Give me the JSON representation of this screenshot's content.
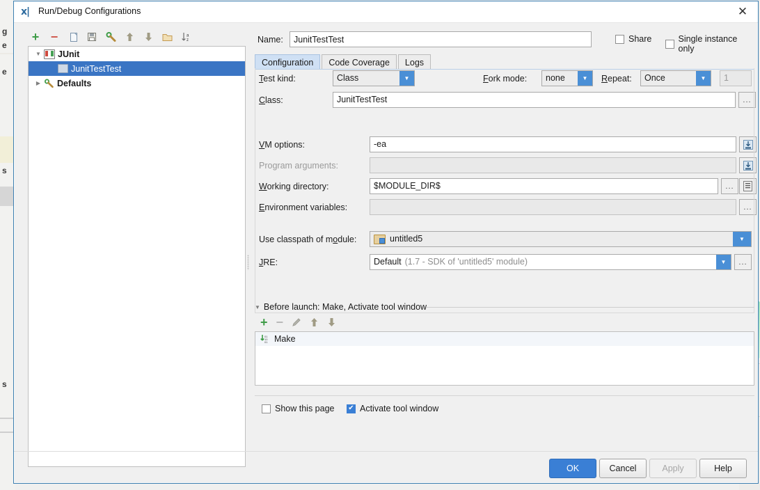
{
  "window": {
    "title": "Run/Debug Configurations",
    "icon": "intellij-junit-icon",
    "close_label": "✕"
  },
  "toolbar": {
    "buttons": [
      {
        "name": "add-configuration-button",
        "glyph": "+",
        "kind": "plus"
      },
      {
        "name": "remove-configuration-button",
        "glyph": "−",
        "kind": "minus"
      },
      {
        "name": "copy-configuration-button",
        "glyph": "",
        "kind": "copy"
      },
      {
        "name": "save-configuration-button",
        "glyph": "",
        "kind": "save"
      },
      {
        "name": "edit-defaults-button",
        "glyph": "",
        "kind": "wrench"
      },
      {
        "name": "move-up-button",
        "glyph": "↑",
        "kind": "up"
      },
      {
        "name": "move-down-button",
        "glyph": "↓",
        "kind": "down"
      },
      {
        "name": "new-folder-button",
        "glyph": "",
        "kind": "folder"
      },
      {
        "name": "sort-alphabetically-button",
        "glyph": "↓",
        "kind": "sort"
      }
    ]
  },
  "tree": {
    "items": [
      {
        "label": "JUnit",
        "level": 0,
        "expanded": true,
        "selected": false,
        "icon": "junit-icon",
        "bold": true
      },
      {
        "label": "JunitTestTest",
        "level": 1,
        "expanded": null,
        "selected": true,
        "icon": "class-icon",
        "bold": false
      },
      {
        "label": "Defaults",
        "level": 0,
        "expanded": false,
        "selected": false,
        "icon": "wrench-icon",
        "bold": true
      }
    ]
  },
  "name_row": {
    "label": "Name:",
    "value": "JunitTestTest",
    "share": {
      "label": "Share",
      "checked": false
    },
    "single_instance": {
      "label": "Single instance only",
      "checked": false
    }
  },
  "tabs": [
    {
      "label": "Configuration",
      "active": true
    },
    {
      "label": "Code Coverage",
      "active": false
    },
    {
      "label": "Logs",
      "active": false
    }
  ],
  "config": {
    "test_kind": {
      "label": "Test kind:",
      "value": "Class"
    },
    "fork_mode": {
      "label": "Fork mode:",
      "value": "none"
    },
    "repeat": {
      "label": "Repeat:",
      "value": "Once",
      "count": "1"
    },
    "class": {
      "label": "Class:",
      "value": "JunitTestTest",
      "browse": "..."
    },
    "vm_options": {
      "label": "VM options:",
      "value": "-ea",
      "expand": "expand-icon"
    },
    "program_arguments": {
      "label": "Program arguments:",
      "value": "",
      "disabled": true,
      "expand": "expand-icon"
    },
    "working_directory": {
      "label": "Working directory:",
      "value": "$MODULE_DIR$",
      "browse": "...",
      "macro": "macro-icon"
    },
    "environment_variables": {
      "label": "Environment variables:",
      "value": "",
      "browse": "..."
    },
    "use_classpath_of_module": {
      "label": "Use classpath of module:",
      "value": "untitled5",
      "icon": "module-icon"
    },
    "jre": {
      "label": "JRE:",
      "value": "Default",
      "hint": "(1.7 - SDK of 'untitled5' module)",
      "browse": "..."
    }
  },
  "before_launch": {
    "title": "Before launch: Make, Activate tool window",
    "toolbar": [
      {
        "name": "add-task-button",
        "kind": "plus"
      },
      {
        "name": "remove-task-button",
        "kind": "minus"
      },
      {
        "name": "edit-task-button",
        "kind": "pencil"
      },
      {
        "name": "task-move-up-button",
        "kind": "up"
      },
      {
        "name": "task-move-down-button",
        "kind": "down"
      }
    ],
    "items": [
      {
        "label": "Make",
        "icon": "make-icon"
      }
    ],
    "show_this_page": {
      "label": "Show this page",
      "checked": false
    },
    "activate_tool_window": {
      "label": "Activate tool window",
      "checked": true
    }
  },
  "footer": {
    "ok": "OK",
    "cancel": "Cancel",
    "apply": "Apply",
    "help": "Help"
  },
  "background": {
    "edge_letters": [
      "g",
      "e",
      "e",
      "s",
      "s"
    ]
  },
  "colors": {
    "accent": "#3a7fd5",
    "selection": "#3a75c4",
    "tab_active": "#cfe0f4",
    "dialog_bg": "#f0f0f0",
    "border": "#3c7fb1"
  }
}
